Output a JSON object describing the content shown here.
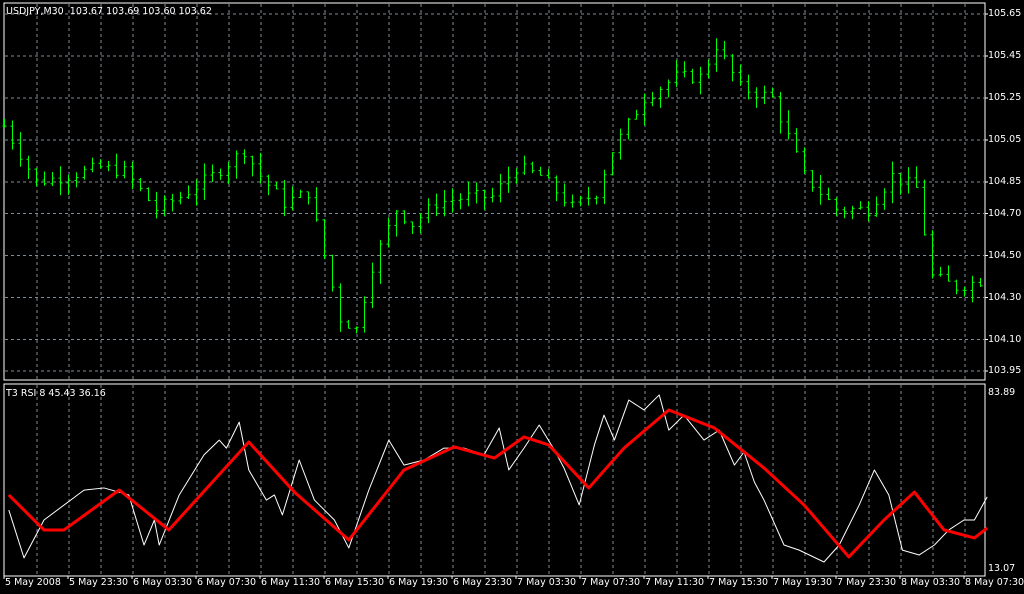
{
  "header": {
    "symbol": "USDJPY,M30",
    "open": "103.67",
    "high": "103.69",
    "low": "103.60",
    "close": "103.62"
  },
  "indicator": {
    "name": "T3 RSI 8",
    "value1": "45.43",
    "value2": "36.16",
    "max_label": "83.89",
    "min_label": "13.07"
  },
  "price_axis": [
    "105.65",
    "105.45",
    "105.25",
    "105.05",
    "104.85",
    "104.70",
    "104.50",
    "104.30",
    "104.10",
    "103.95"
  ],
  "time_axis": [
    "5 May 2008",
    "5 May 23:30",
    "6 May 03:30",
    "6 May 07:30",
    "6 May 11:30",
    "6 May 15:30",
    "6 May 19:30",
    "6 May 23:30",
    "7 May 03:30",
    "7 May 07:30",
    "7 May 11:30",
    "7 May 15:30",
    "7 May 19:30",
    "7 May 23:30",
    "8 May 03:30",
    "8 May 07:30"
  ],
  "colors": {
    "bars": "#00ff00",
    "grid": "#7f8c99",
    "rsi": "#ffffff",
    "t3": "#ff0000"
  },
  "chart_data": {
    "type": "line",
    "price_range": [
      103.95,
      105.65
    ],
    "price_path": {
      "bar": [
        1,
        4,
        8,
        12,
        15,
        19,
        22,
        26,
        30,
        32,
        35,
        38,
        40,
        42,
        44,
        46,
        49,
        51,
        54,
        58,
        61,
        64,
        67,
        71,
        74,
        76,
        80,
        84,
        87,
        89,
        92,
        96,
        100,
        104,
        108,
        111,
        114,
        116,
        119,
        122
      ],
      "price": [
        105.05,
        104.85,
        104.88,
        104.92,
        104.9,
        104.72,
        104.78,
        104.88,
        105.0,
        104.88,
        104.75,
        104.8,
        104.5,
        104.2,
        104.15,
        104.45,
        104.72,
        104.65,
        104.75,
        104.78,
        104.78,
        104.92,
        104.88,
        104.73,
        104.8,
        105.0,
        105.25,
        105.35,
        105.35,
        105.5,
        105.3,
        105.25,
        104.88,
        104.72,
        104.72,
        104.88,
        104.82,
        104.4,
        104.35,
        104.38
      ]
    },
    "rsi_range": [
      13.07,
      83.89
    ],
    "rsi": {
      "bar": [
        0.6,
        2.5,
        5,
        10,
        12.5,
        15.6,
        17.5,
        18.8,
        19.4,
        21.9,
        25,
        26.9,
        27.8,
        29.4,
        30.6,
        32.8,
        33.8,
        34.8,
        36.9,
        38.8,
        41.3,
        43.1,
        45.6,
        48.1,
        50,
        52.5,
        55,
        57.5,
        60,
        61.9,
        63.1,
        65,
        66.9,
        68.8,
        70,
        71.9,
        73.8,
        75,
        76.3,
        78.1,
        80,
        81.9,
        83.1,
        85,
        87.5,
        89.4,
        91.3,
        92.5,
        93.8,
        95,
        97.5,
        99.4,
        102.5,
        104.4,
        106.9,
        108.8,
        110.6,
        112.3,
        114.4,
        116.3,
        118.1,
        120,
        121.3,
        122.9
      ],
      "value": [
        35.7,
        16.0,
        31.6,
        43.9,
        44.8,
        41.9,
        21.3,
        31.6,
        21.3,
        41.9,
        58.4,
        64.5,
        61.2,
        71.9,
        52.2,
        39.8,
        41.9,
        33.7,
        56.3,
        39.8,
        31.6,
        20.1,
        43.9,
        64.5,
        54.2,
        56.3,
        61.2,
        61.2,
        58.4,
        69.5,
        52.2,
        61.2,
        70.7,
        60.4,
        53.0,
        37.8,
        62.5,
        74.8,
        64.5,
        81.0,
        76.9,
        83.1,
        68.6,
        74.8,
        64.5,
        68.6,
        54.2,
        59.6,
        47.2,
        39.8,
        21.3,
        19.2,
        14.3,
        21.3,
        37.8,
        52.2,
        41.9,
        19.2,
        17.2,
        21.3,
        27.5,
        31.6,
        31.6,
        41.1
      ]
    },
    "t3": {
      "bar": [
        0.6,
        5,
        7.5,
        14.4,
        20.6,
        30.6,
        36.3,
        43.1,
        50,
        56.3,
        61.3,
        65,
        68.1,
        73.1,
        77.5,
        83.1,
        88.8,
        95,
        100,
        105.6,
        110,
        113.8,
        117.5,
        121.3,
        122.9
      ],
      "value": [
        41.9,
        27.5,
        27.5,
        43.95,
        27.5,
        63.7,
        43.1,
        23.4,
        52.2,
        61.7,
        57.1,
        65.8,
        62.5,
        44.8,
        61.2,
        76.9,
        69.5,
        53.0,
        37.8,
        16.4,
        31.6,
        43.1,
        27.5,
        24.2,
        28.3
      ]
    }
  }
}
